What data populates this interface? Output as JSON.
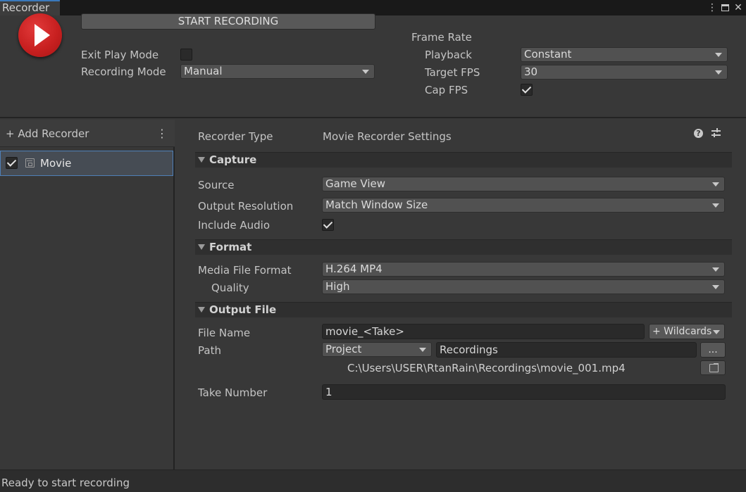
{
  "window": {
    "tab_title": "Recorder",
    "menu_glyph": "⋮",
    "close_glyph": "✕"
  },
  "header": {
    "start_label": "START RECORDING",
    "exit_play_mode_label": "Exit Play Mode",
    "exit_play_mode_checked": false,
    "recording_mode_label": "Recording Mode",
    "recording_mode_value": "Manual",
    "frame_rate_label": "Frame Rate",
    "playback_label": "Playback",
    "playback_value": "Constant",
    "target_fps_label": "Target FPS",
    "target_fps_value": "30",
    "cap_fps_label": "Cap FPS",
    "cap_fps_checked": true
  },
  "left_pane": {
    "add_recorder_label": "+ Add Recorder",
    "menu_glyph": "⋮",
    "recorders": [
      {
        "label": "Movie",
        "enabled": true,
        "selected": true
      }
    ]
  },
  "settings": {
    "recorder_type_label": "Recorder Type",
    "recorder_type_value": "Movie Recorder Settings",
    "help_glyph": "?",
    "capture": {
      "title": "Capture",
      "source_label": "Source",
      "source_value": "Game View",
      "output_resolution_label": "Output Resolution",
      "output_resolution_value": "Match Window Size",
      "include_audio_label": "Include Audio",
      "include_audio_checked": true
    },
    "format": {
      "title": "Format",
      "media_file_format_label": "Media File Format",
      "media_file_format_value": "H.264 MP4",
      "quality_label": "Quality",
      "quality_value": "High"
    },
    "output_file": {
      "title": "Output File",
      "file_name_label": "File Name",
      "file_name_value": "movie_<Take>",
      "wildcards_label": "+ Wildcards",
      "path_label": "Path",
      "path_root_value": "Project",
      "path_folder_value": "Recordings",
      "browse_label": "...",
      "full_path": "C:\\Users\\USER\\RtanRain\\Recordings\\movie_001.mp4",
      "take_number_label": "Take Number",
      "take_number_value": "1"
    }
  },
  "status": {
    "text": "Ready to start recording"
  },
  "colors": {
    "selection_border": "#4f80b8",
    "record_red": "#c82020",
    "tab_accent": "#3a79bb"
  }
}
